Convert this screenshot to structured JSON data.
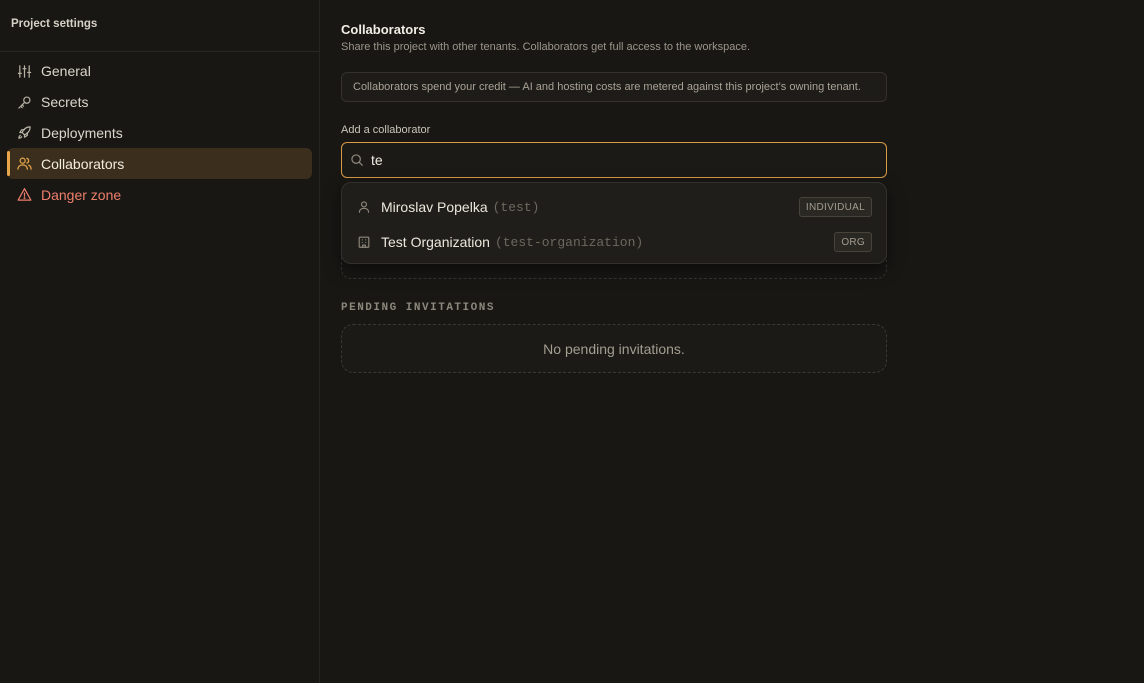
{
  "sidebar": {
    "title": "Project settings",
    "items": [
      {
        "label": "General",
        "icon": "sliders-icon"
      },
      {
        "label": "Secrets",
        "icon": "key-icon"
      },
      {
        "label": "Deployments",
        "icon": "rocket-icon"
      },
      {
        "label": "Collaborators",
        "icon": "users-icon",
        "active": true
      },
      {
        "label": "Danger zone",
        "icon": "warning-icon",
        "danger": true
      }
    ]
  },
  "main": {
    "title": "Collaborators",
    "subtitle": "Share this project with other tenants. Collaborators get full access to the workspace.",
    "notice": "Collaborators spend your credit — AI and hosting costs are metered against this project’s owning tenant.",
    "add_label": "Add a collaborator",
    "search": {
      "value": "te",
      "icon": "search-icon"
    },
    "results": [
      {
        "name": "Miroslav Popelka",
        "handle": "(test)",
        "badge": "INDIVIDUAL",
        "icon": "user-icon"
      },
      {
        "name": "Test Organization",
        "handle": "(test-organization)",
        "badge": "ORG",
        "icon": "building-icon"
      }
    ],
    "pending_title": "PENDING INVITATIONS",
    "pending_empty": "No pending invitations."
  },
  "colors": {
    "background": "#181714",
    "accent": "#e7a64a",
    "active_bg": "#3b2e1c",
    "danger": "#ef7f6c"
  }
}
